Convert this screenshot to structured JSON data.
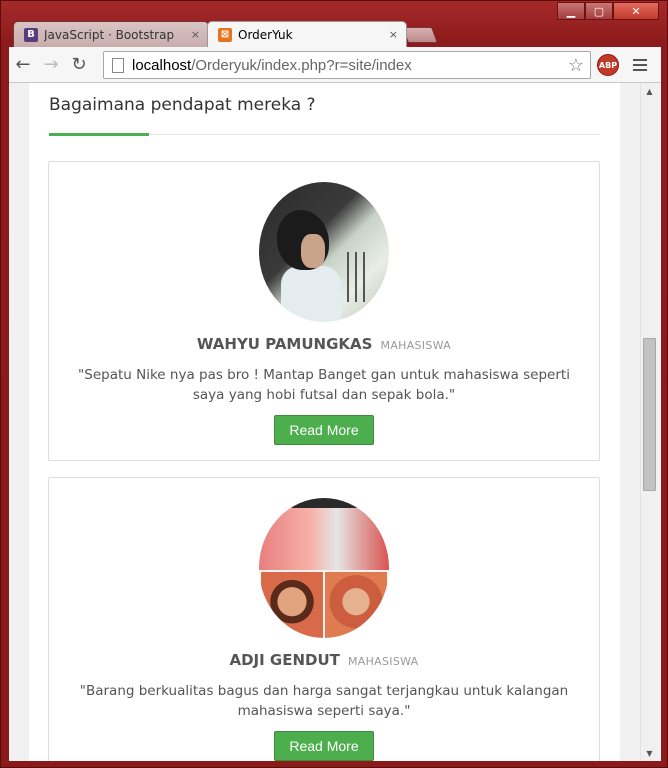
{
  "window": {
    "minimize_glyph": "▁",
    "maximize_glyph": "▢",
    "close_glyph": "✕"
  },
  "tabs": [
    {
      "title": "JavaScript · Bootstrap",
      "favicon_letter": "B",
      "favicon_color": "#563d7c",
      "close": "×"
    },
    {
      "title": "OrderYuk",
      "favicon_letter": "⊠",
      "favicon_color": "#e8731e",
      "close": "×"
    }
  ],
  "toolbar": {
    "back": "←",
    "forward": "→",
    "reload": "↻",
    "url_host": "localhost",
    "url_path": "/Orderyuk/index.php?r=site/index",
    "star": "☆",
    "abp_label": "ABP"
  },
  "section": {
    "title": "Bagaimana pendapat mereka ?",
    "accent_color": "#4caf50"
  },
  "testimonials": [
    {
      "name": "WAHYU PAMUNGKAS",
      "role": "MAHASISWA",
      "quote": "\"Sepatu Nike nya pas bro ! Mantap Banget gan untuk mahasiswa seperti saya yang hobi futsal dan sepak bola.\"",
      "button": "Read More"
    },
    {
      "name": "ADJI GENDUT",
      "role": "MAHASISWA",
      "quote": "\"Barang berkualitas bagus dan harga sangat terjangkau untuk kalangan mahasiswa seperti saya.\"",
      "button": "Read More"
    }
  ],
  "scrollbar": {
    "up": "▲",
    "down": "▼"
  }
}
